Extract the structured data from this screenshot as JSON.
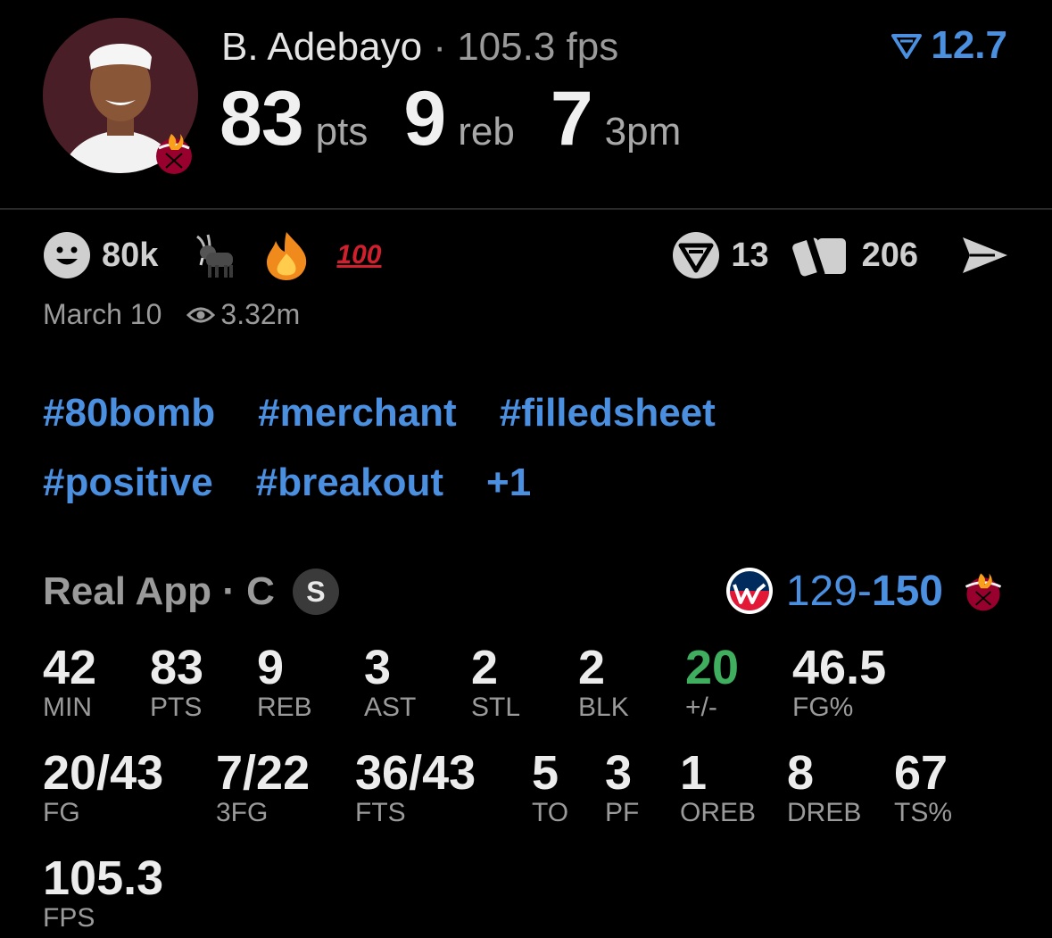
{
  "player": {
    "name": "B. Adebayo",
    "separator": "·",
    "fps_text": "105.3 fps",
    "headline": [
      {
        "value": "83",
        "unit": "pts"
      },
      {
        "value": "9",
        "unit": "reb"
      },
      {
        "value": "7",
        "unit": "3pm"
      }
    ],
    "rating": "12.7",
    "rating_icon": "v-logo-icon"
  },
  "reactions": {
    "smile_count": "80k",
    "icons": [
      "smile-icon",
      "goat-emoji",
      "fire-emoji",
      "hundred-emoji"
    ],
    "hundred_text": "100",
    "comments_count": "13",
    "cards_count": "206"
  },
  "meta": {
    "date": "March 10",
    "views": "3.32m"
  },
  "tags": {
    "row1": [
      "#80bomb",
      "#merchant",
      "#filledsheet"
    ],
    "row2": [
      "#positive",
      "#breakout",
      "+1"
    ]
  },
  "box": {
    "source": "Real App · C",
    "badge": "S",
    "away_score": "129",
    "dash": "-",
    "home_score": "150",
    "rows": [
      [
        {
          "value": "42",
          "label": "MIN"
        },
        {
          "value": "83",
          "label": "PTS"
        },
        {
          "value": "9",
          "label": "REB"
        },
        {
          "value": "3",
          "label": "AST"
        },
        {
          "value": "2",
          "label": "STL"
        },
        {
          "value": "2",
          "label": "BLK"
        },
        {
          "value": "20",
          "label": "+/-"
        },
        {
          "value": "46.5",
          "label": "FG%"
        }
      ],
      [
        {
          "value": "20/43",
          "label": "FG"
        },
        {
          "value": "7/22",
          "label": "3FG"
        },
        {
          "value": "36/43",
          "label": "FTS"
        },
        {
          "value": "5",
          "label": "TO"
        },
        {
          "value": "3",
          "label": "PF"
        },
        {
          "value": "1",
          "label": "OREB"
        },
        {
          "value": "8",
          "label": "DREB"
        },
        {
          "value": "67",
          "label": "TS%"
        }
      ],
      [
        {
          "value": "105.3",
          "label": "FPS"
        }
      ]
    ]
  },
  "colors": {
    "accent": "#4a8fe0",
    "positive": "#3fae5f",
    "background": "#000000",
    "muted": "#9a9a9a"
  }
}
